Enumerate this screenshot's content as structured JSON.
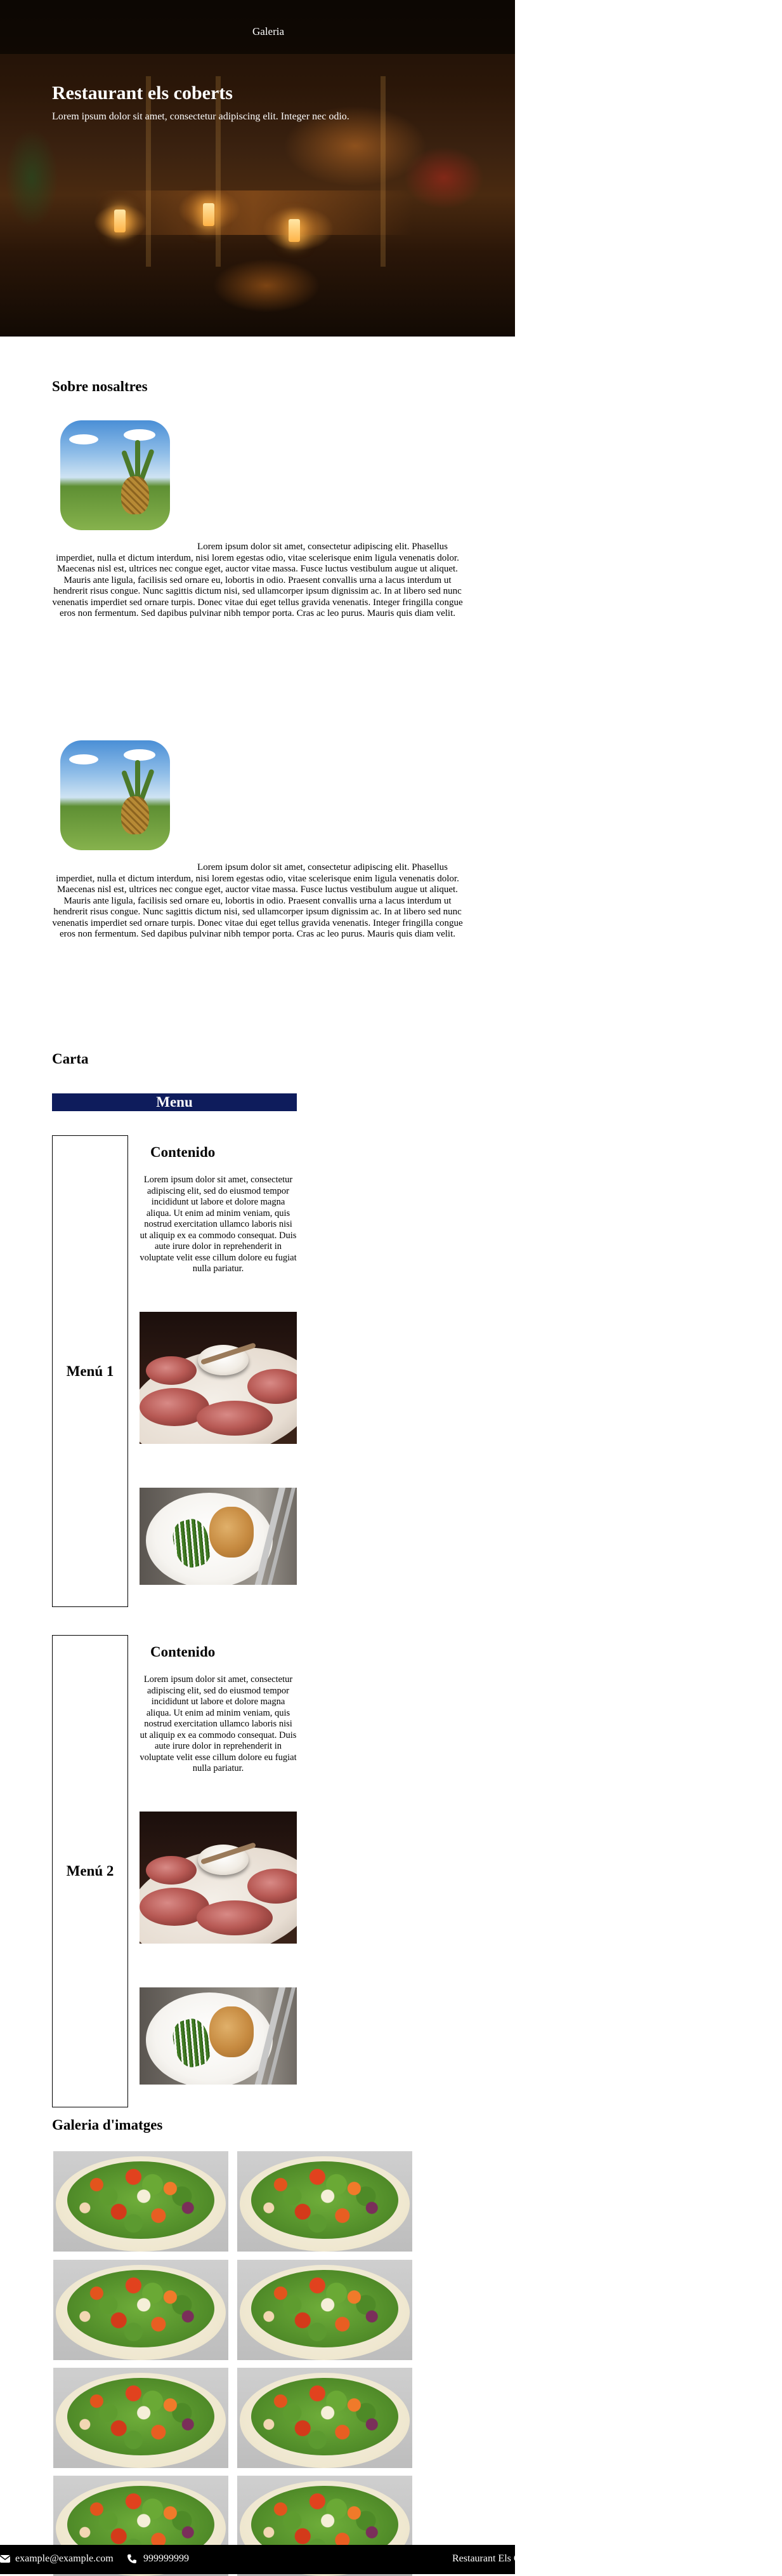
{
  "nav": {
    "link_label": "Galeria"
  },
  "hero": {
    "title": "Restaurant els coberts",
    "subtitle": "Lorem ipsum dolor sit amet, consectetur adipiscing elit. Integer nec odio."
  },
  "about": {
    "title": "Sobre nosaltres",
    "blocks": [
      {
        "image_alt": "pineapple-photo",
        "text": "Lorem ipsum dolor sit amet, consectetur adipiscing elit. Phasellus imperdiet, nulla et dictum interdum, nisi lorem egestas odio, vitae scelerisque enim ligula venenatis dolor. Maecenas nisl est, ultrices nec congue eget, auctor vitae massa. Fusce luctus vestibulum augue ut aliquet. Mauris ante ligula, facilisis sed ornare eu, lobortis in odio. Praesent convallis urna a lacus interdum ut hendrerit risus congue. Nunc sagittis dictum nisi, sed ullamcorper ipsum dignissim ac. In at libero sed nunc venenatis imperdiet sed ornare turpis. Donec vitae dui eget tellus gravida venenatis. Integer fringilla congue eros non fermentum. Sed dapibus pulvinar nibh tempor porta. Cras ac leo purus. Mauris quis diam velit."
      },
      {
        "image_alt": "pineapple-photo",
        "text": "Lorem ipsum dolor sit amet, consectetur adipiscing elit. Phasellus imperdiet, nulla et dictum interdum, nisi lorem egestas odio, vitae scelerisque enim ligula venenatis dolor. Maecenas nisl est, ultrices nec congue eget, auctor vitae massa. Fusce luctus vestibulum augue ut aliquet. Mauris ante ligula, facilisis sed ornare eu, lobortis in odio. Praesent convallis urna a lacus interdum ut hendrerit risus congue. Nunc sagittis dictum nisi, sed ullamcorper ipsum dignissim ac. In at libero sed nunc venenatis imperdiet sed ornare turpis. Donec vitae dui eget tellus gravida venenatis. Integer fringilla congue eros non fermentum. Sed dapibus pulvinar nibh tempor porta. Cras ac leo purus. Mauris quis diam velit."
      }
    ]
  },
  "carta": {
    "title": "Carta",
    "menu_header": "Menu",
    "menus": [
      {
        "label": "Menú 1",
        "content_title": "Contenido",
        "content_text": "Lorem ipsum dolor sit amet, consectetur adipiscing elit, sed do eiusmod tempor incididunt ut labore et dolore magna aliqua. Ut enim ad minim veniam, quis nostrud exercitation ullamco laboris nisi ut aliquip ex ea commodo consequat. Duis aute irure dolor in reprehenderit in voluptate velit esse cillum dolore eu fugiat nulla pariatur."
      },
      {
        "label": "Menú 2",
        "content_title": "Contenido",
        "content_text": "Lorem ipsum dolor sit amet, consectetur adipiscing elit, sed do eiusmod tempor incididunt ut labore et dolore magna aliqua. Ut enim ad minim veniam, quis nostrud exercitation ullamco laboris nisi ut aliquip ex ea commodo consequat. Duis aute irure dolor in reprehenderit in voluptate velit esse cillum dolore eu fugiat nulla pariatur."
      }
    ]
  },
  "gallery": {
    "title": "Galeria d'imatges",
    "image_count": 8
  },
  "footer": {
    "email": "example@example.com",
    "phone": "999999999",
    "brand": "Restaurant Els Coberts",
    "email_icon": "envelope-icon",
    "phone_icon": "phone-icon"
  },
  "colors": {
    "menu_header_bg": "#0e1c5c",
    "footer_bg": "#000000"
  }
}
